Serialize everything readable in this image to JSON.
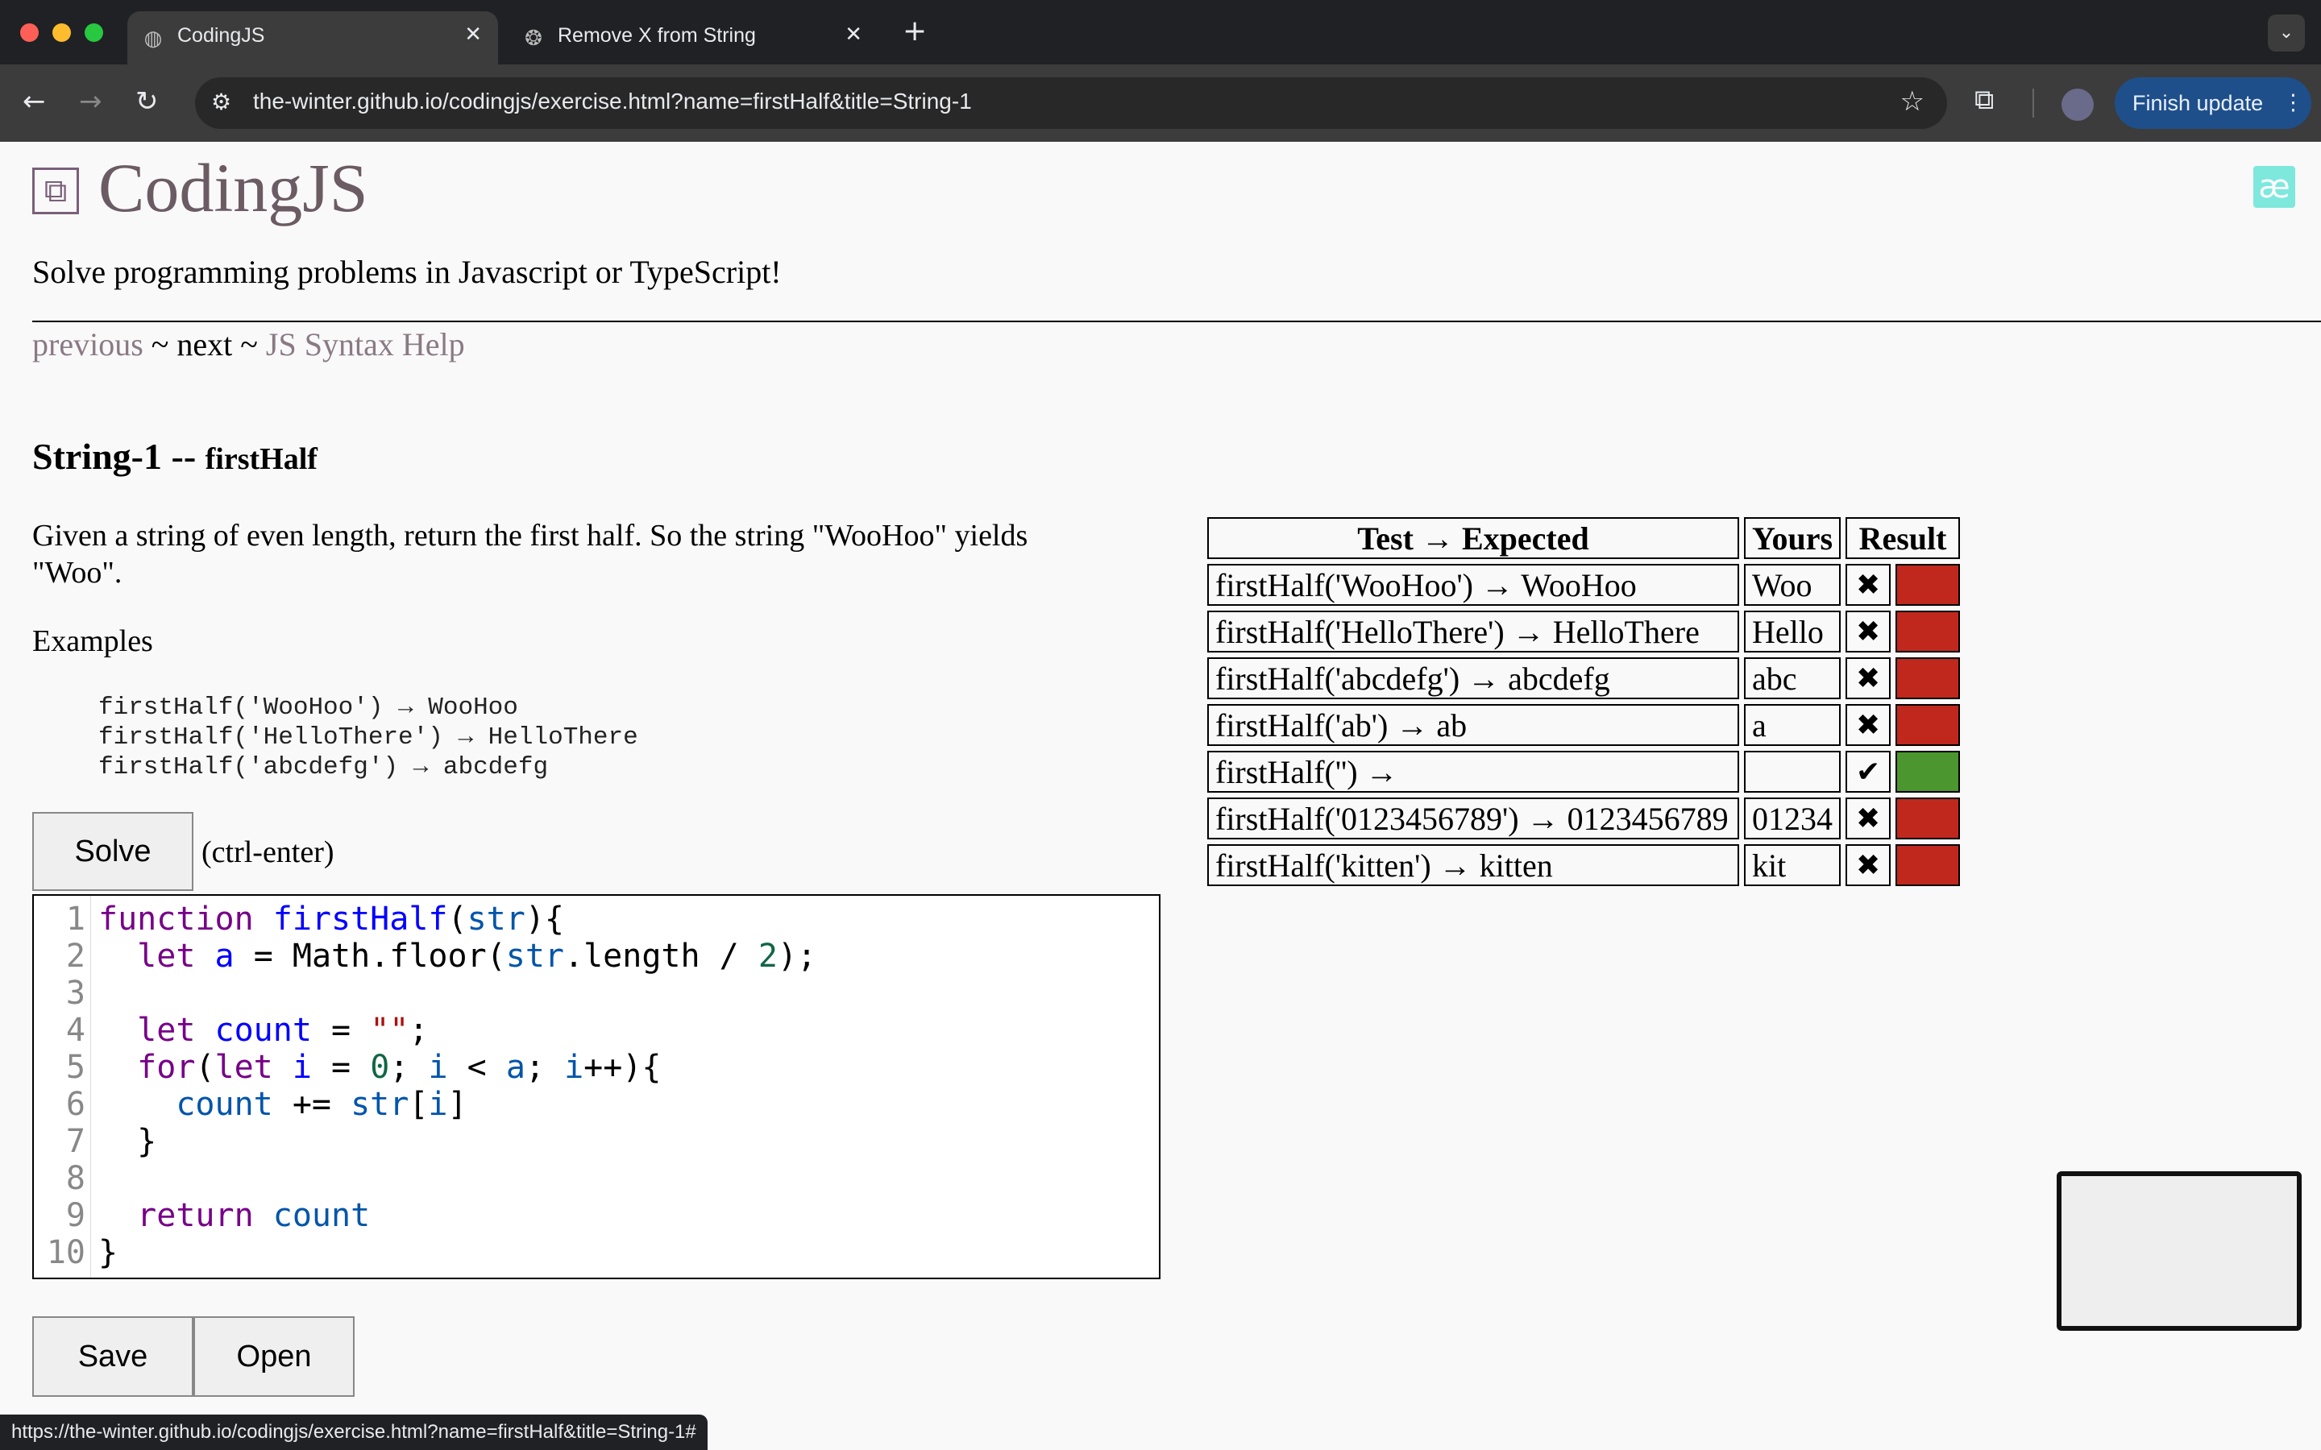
{
  "browser": {
    "tabs": [
      {
        "title": "CodingJS",
        "active": true
      },
      {
        "title": "Remove X from String",
        "active": false
      }
    ],
    "url": "the-winter.github.io/codingjs/exercise.html?name=firstHalf&title=String-1",
    "finish_update": "Finish update",
    "status_url": "https://the-winter.github.io/codingjs/exercise.html?name=firstHalf&title=String-1#",
    "traffic_colors": [
      "#ff5f57",
      "#febc2e",
      "#28c840"
    ]
  },
  "page": {
    "site_title": "CodingJS",
    "tagline": "Solve programming problems in Javascript or TypeScript!",
    "nav": {
      "previous": "previous",
      "sep1": " ~ ",
      "next": "next",
      "sep2": " ~ ",
      "help": "JS Syntax Help"
    },
    "exercise": {
      "category": "String-1 -- ",
      "name": "firstHalf"
    },
    "description": "Given a string of even length, return the first half. So the string \"WooHoo\" yields \"Woo\".",
    "examples_label": "Examples",
    "examples": [
      "firstHalf('WooHoo') → WooHoo",
      "firstHalf('HelloThere') → HelloThere",
      "firstHalf('abcdefg') → abcdefg"
    ],
    "solve_label": "Solve",
    "solve_hint": "(ctrl-enter)",
    "save_label": "Save",
    "open_label": "Open",
    "line_numbers": "1\n2\n3\n4\n5\n6\n7\n8\n9\n10"
  },
  "results": {
    "headers": [
      "Test → Expected",
      "Yours",
      "Result"
    ],
    "colors": {
      "fail": "#c0281e",
      "pass": "#4c9630"
    },
    "rows": [
      {
        "test": "firstHalf('WooHoo') → WooHoo",
        "yours": "Woo",
        "mark": "✖",
        "status": "fail"
      },
      {
        "test": "firstHalf('HelloThere') → HelloThere",
        "yours": "Hello",
        "mark": "✖",
        "status": "fail"
      },
      {
        "test": "firstHalf('abcdefg') → abcdefg",
        "yours": "abc",
        "mark": "✖",
        "status": "fail"
      },
      {
        "test": "firstHalf('ab') → ab",
        "yours": "a",
        "mark": "✖",
        "status": "fail"
      },
      {
        "test": "firstHalf('') →",
        "yours": "",
        "mark": "✔",
        "status": "pass"
      },
      {
        "test": "firstHalf('0123456789') → 0123456789",
        "yours": "01234",
        "mark": "✖",
        "status": "fail"
      },
      {
        "test": "firstHalf('kitten') → kitten",
        "yours": "kit",
        "mark": "✖",
        "status": "fail"
      }
    ]
  },
  "code": {
    "function": "function",
    "name": "firstHalf",
    "param": "str",
    "let": "let",
    "a": "a",
    "math": "Math.floor(",
    "length": ".length / ",
    "two": "2",
    "count": "count",
    "empty": "\"\"",
    "for": "for",
    "i": "i",
    "zero": "0",
    "return": "return"
  }
}
